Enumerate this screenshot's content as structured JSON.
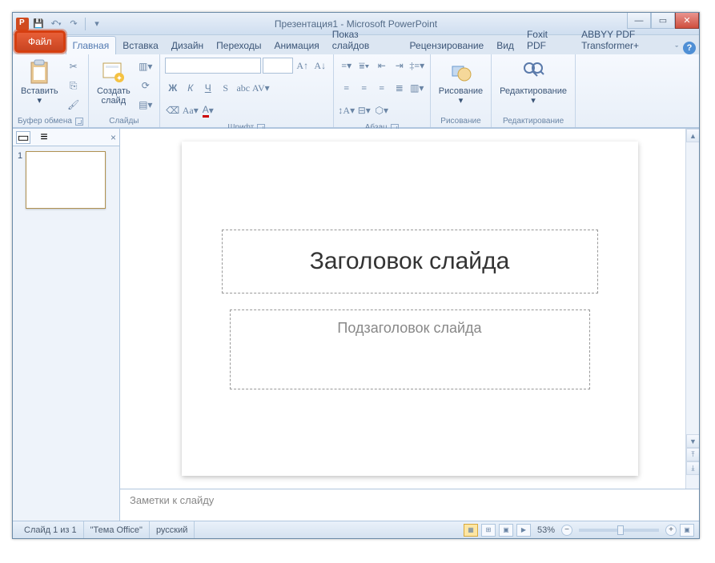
{
  "title": "Презентация1 - Microsoft PowerPoint",
  "tabs": {
    "file": "Файл",
    "list": [
      "Главная",
      "Вставка",
      "Дизайн",
      "Переходы",
      "Анимация",
      "Показ слайдов",
      "Рецензирование",
      "Вид",
      "Foxit PDF",
      "ABBYY PDF Transformer+"
    ]
  },
  "ribbon": {
    "clipboard": {
      "label": "Буфер обмена",
      "paste": "Вставить"
    },
    "slides": {
      "label": "Слайды",
      "new": "Создать\nслайд"
    },
    "font": {
      "label": "Шрифт"
    },
    "paragraph": {
      "label": "Абзац"
    },
    "drawing": {
      "label": "Рисование",
      "btn": "Рисование"
    },
    "editing": {
      "label": "Редактирование",
      "btn": "Редактирование"
    }
  },
  "slide": {
    "number": "1",
    "title_ph": "Заголовок слайда",
    "subtitle_ph": "Подзаголовок слайда"
  },
  "notes": "Заметки к слайду",
  "status": {
    "slide": "Слайд 1 из 1",
    "theme": "\"Тема Office\"",
    "lang": "русский",
    "zoom": "53%"
  }
}
